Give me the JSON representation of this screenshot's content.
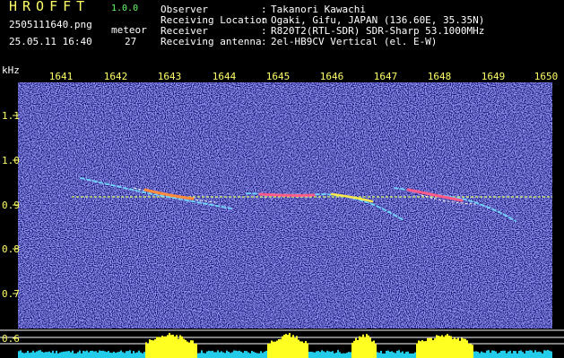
{
  "header": {
    "brand": "HROFFT",
    "version": "1.0.0",
    "filename": "2505111640.png",
    "meteor_label": "meteor",
    "datetime": "25.05.11 16:40",
    "meteor_count": "27"
  },
  "info": [
    {
      "label": "Observer",
      "value": "Takanori Kawachi"
    },
    {
      "label": "Receiving Location",
      "value": "Ogaki, Gifu, JAPAN (136.60E, 35.35N)"
    },
    {
      "label": "Receiver",
      "value": "R820T2(RTL-SDR) SDR-Sharp 53.1000MHz"
    },
    {
      "label": "Receiving antenna",
      "value": "2el-HB9CV Vertical (el. E-W)"
    }
  ],
  "info_separator": ":",
  "axes": {
    "y_unit": "kHz",
    "x_ticks": [
      "1641",
      "1642",
      "1643",
      "1644",
      "1645",
      "1646",
      "1647",
      "1648",
      "1649",
      "1650"
    ],
    "y_ticks": [
      "1.1",
      "1.0",
      "0.9",
      "0.8",
      "0.7",
      "0.6"
    ]
  },
  "colors": {
    "background": "#000000",
    "plot_background": "#000060",
    "text_white": "#ffffff",
    "text_yellow": "#ffff66",
    "text_green": "#66ff66",
    "carrier": "#d9ff66",
    "meteor_echo": "#ffffff",
    "level_bar_yellow": "#ffff22",
    "level_bar_cyan": "#22cce8",
    "reference_line": "#ffffff"
  }
}
